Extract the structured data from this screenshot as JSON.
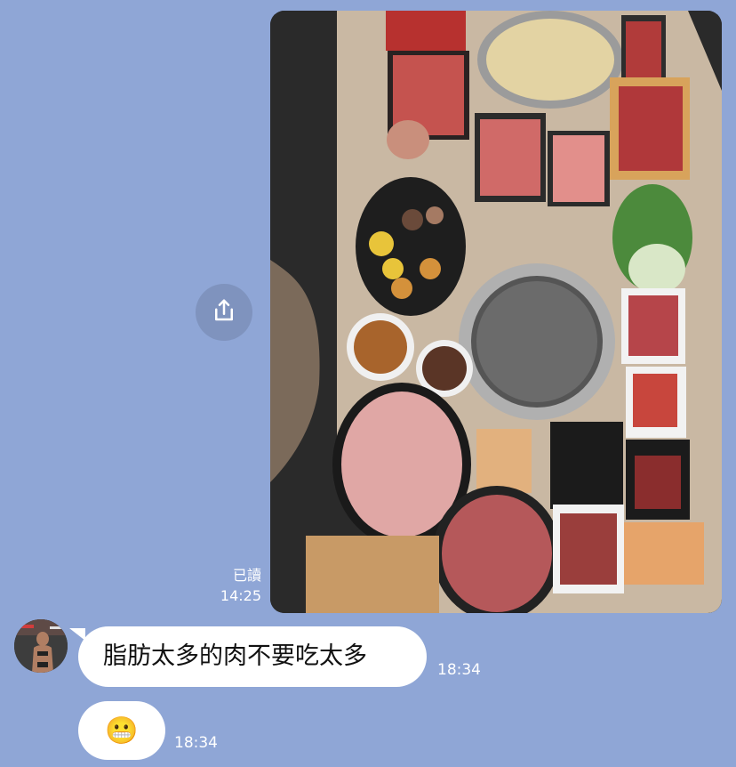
{
  "chat": {
    "outgoing_image": {
      "read_status": "已讀",
      "time": "14:25"
    },
    "incoming_messages": [
      {
        "text": "脂肪太多的肉不要吃太多",
        "time": "18:34"
      },
      {
        "text": "😬",
        "time": "18:34"
      }
    ]
  },
  "icons": {
    "share": "share-icon",
    "emoji": "grimacing-face"
  },
  "colors": {
    "background": "#8fa6d6",
    "bubble": "#ffffff",
    "share_button": "#7f93be"
  }
}
